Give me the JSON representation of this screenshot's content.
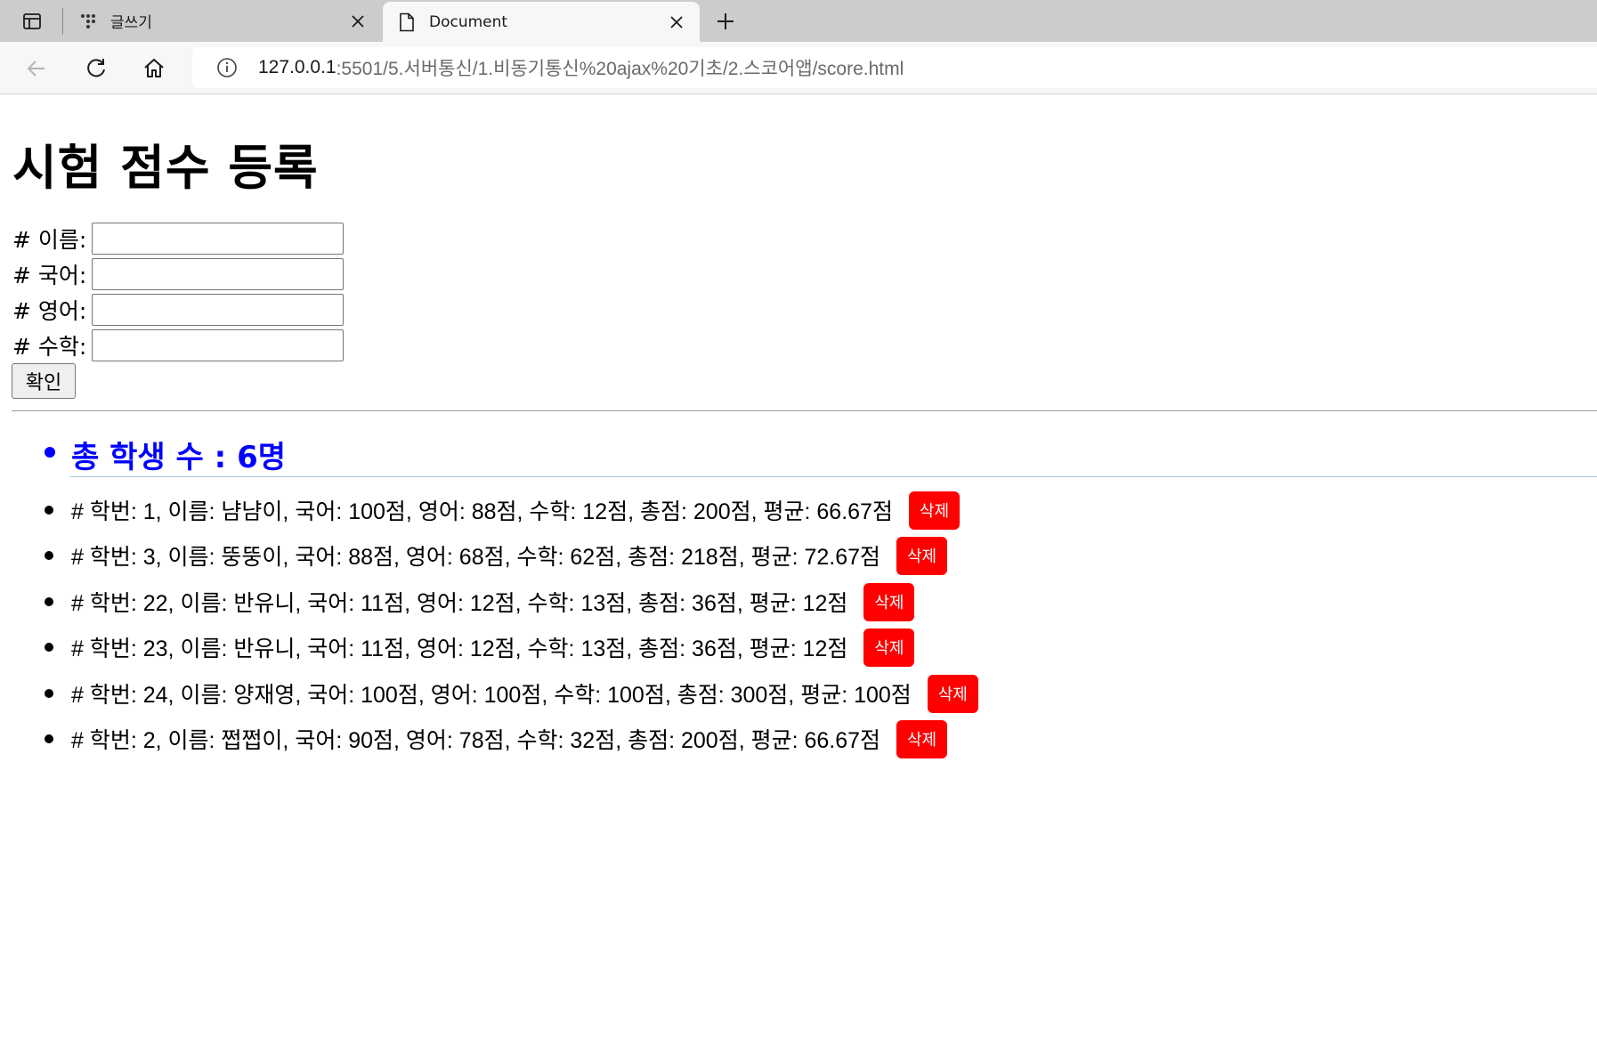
{
  "browser": {
    "tabs": [
      {
        "title": "글쓰기",
        "icon": "app-dots-icon",
        "active": false
      },
      {
        "title": "Document",
        "icon": "document-icon",
        "active": true
      }
    ],
    "url_host": "127.0.0.1",
    "url_path": ":5501/5.서버통신/1.비동기통신%20ajax%20기초/2.스코어앱/score.html"
  },
  "page": {
    "title": "시험 점수 등록",
    "form": {
      "name_label": "# 이름:",
      "korean_label": "# 국어:",
      "english_label": "# 영어:",
      "math_label": "# 수학:",
      "name_value": "",
      "korean_value": "",
      "english_value": "",
      "math_value": "",
      "confirm_label": "확인"
    },
    "total_label": "총 학생 수 : 6명",
    "delete_label": "삭제",
    "scores": [
      {
        "text": "# 학번: 1, 이름: 냠냠이, 국어: 100점, 영어: 88점, 수학: 12점, 총점: 200점, 평균: 66.67점"
      },
      {
        "text": "# 학번: 3, 이름: 뚱뚱이, 국어: 88점, 영어: 68점, 수학: 62점, 총점: 218점, 평균: 72.67점"
      },
      {
        "text": "# 학번: 22, 이름: 반유니, 국어: 11점, 영어: 12점, 수학: 13점, 총점: 36점, 평균: 12점"
      },
      {
        "text": "# 학번: 23, 이름: 반유니, 국어: 11점, 영어: 12점, 수학: 13점, 총점: 36점, 평균: 12점"
      },
      {
        "text": "# 학번: 24, 이름: 양재영, 국어: 100점, 영어: 100점, 수학: 100점, 총점: 300점, 평균: 100점"
      },
      {
        "text": "# 학번: 2, 이름: 쩝쩝이, 국어: 90점, 영어: 78점, 수학: 32점, 총점: 200점, 평균: 66.67점"
      }
    ]
  },
  "colors": {
    "total_text": "#0000ff",
    "delete_button": "#ff0000",
    "tabbar": "#cccccc",
    "toolbar": "#f7f7f7"
  }
}
